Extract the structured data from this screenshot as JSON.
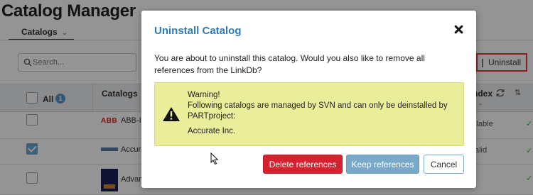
{
  "app": {
    "page_title": "Catalog Manager",
    "tab_label": "Catalogs",
    "search_placeholder": "Search...",
    "uninstall_label": "Uninstall"
  },
  "table": {
    "header": {
      "all_label": "All",
      "selected_count": "1",
      "catalogs_label": "Catalogs",
      "index_label": "ndex"
    },
    "rows": [
      {
        "name": "ABB-I",
        "status": "ilable",
        "checked": false
      },
      {
        "name": "Accura",
        "status": "alid",
        "checked": true
      },
      {
        "name": "Advan",
        "status": "",
        "checked": false
      }
    ]
  },
  "modal": {
    "title": "Uninstall Catalog",
    "message": "You are about to uninstall this catalog. Would you also like to remove all references from the LinkDb?",
    "warning": {
      "heading": "Warning!",
      "body": "Following catalogs are managed by SVN and can only be deinstalled by PARTproject:",
      "catalog": "Accurate Inc."
    },
    "buttons": {
      "delete": "Delete references",
      "keep": "Keep references",
      "cancel": "Cancel"
    }
  },
  "colors": {
    "accent": "#2e7bb2",
    "danger": "#d4222e",
    "warning_bg": "#eaee9a"
  },
  "icons": [
    "chevron-down-icon",
    "search-icon",
    "refresh-icon",
    "sort-icon",
    "close-icon",
    "warning-icon",
    "mouse-cursor-icon"
  ]
}
